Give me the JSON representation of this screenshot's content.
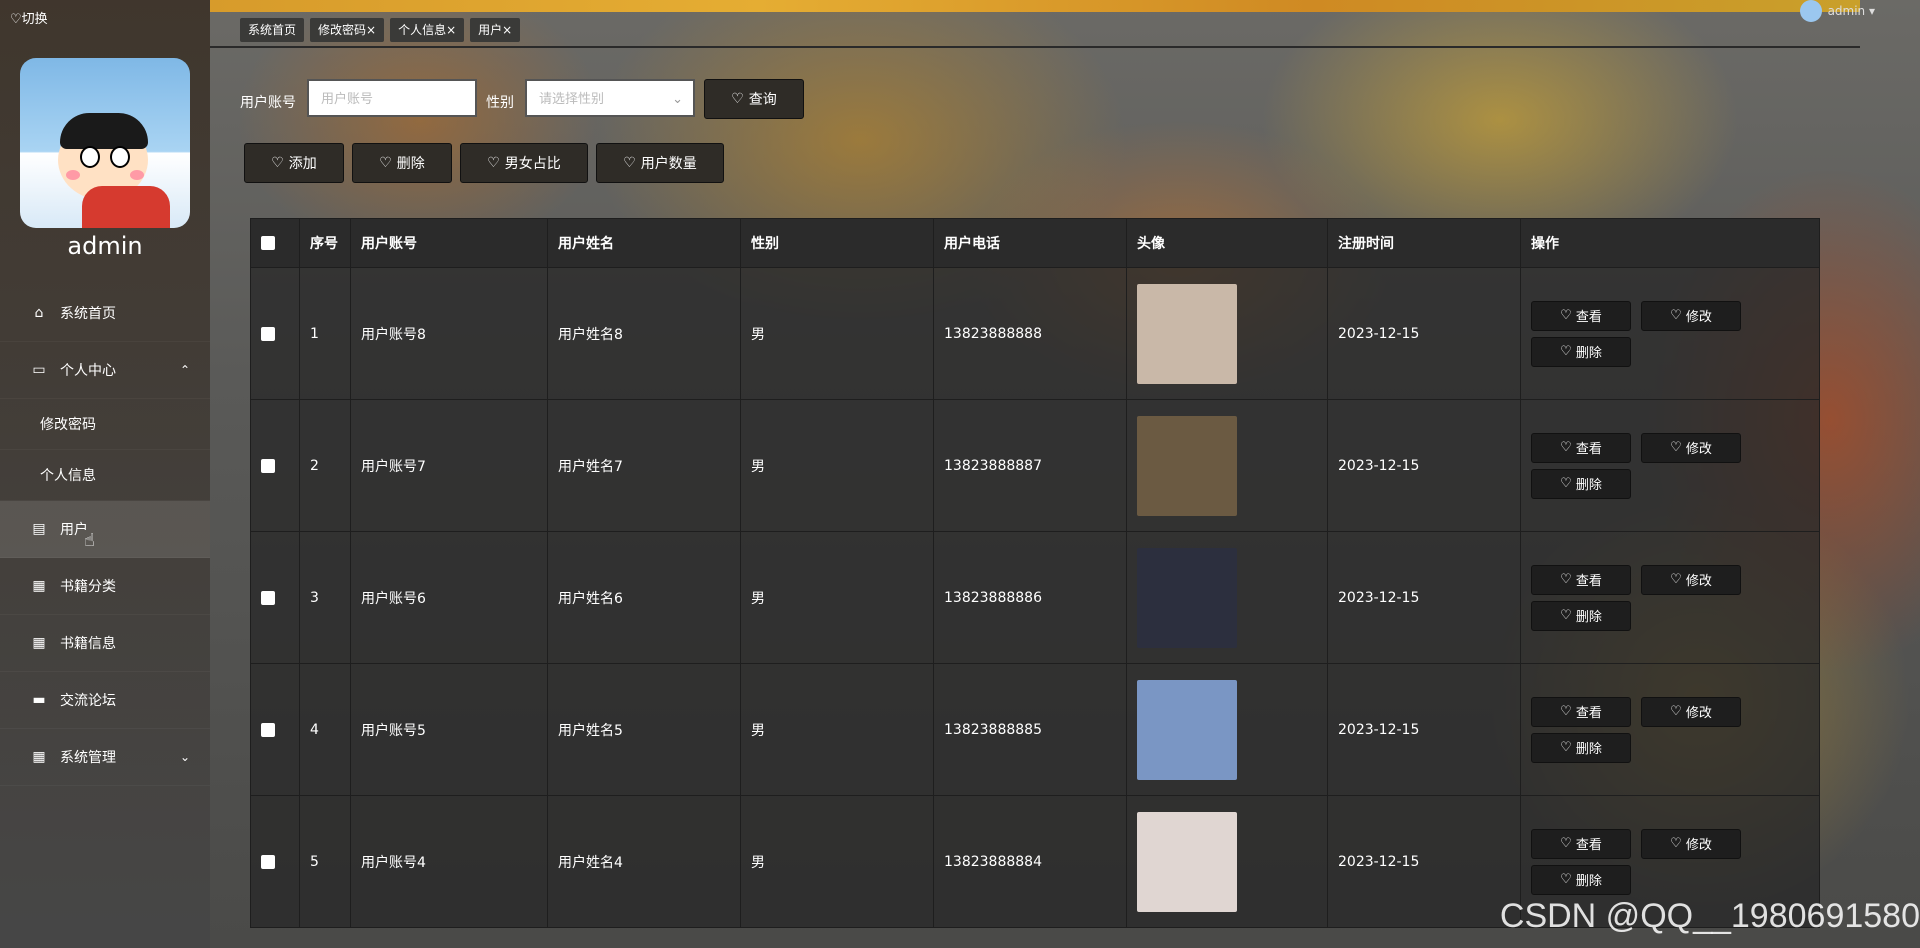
{
  "top": {
    "switch_label": "♡切换",
    "user_label": "admin ▾",
    "tabs": [
      "系统首页",
      "修改密码×",
      "个人信息×",
      "用户×"
    ]
  },
  "sidebar": {
    "username": "admin",
    "items": [
      {
        "icon": "home-icon",
        "glyph": "⌂",
        "label": "系统首页"
      },
      {
        "icon": "card-icon",
        "glyph": "▭",
        "label": "个人中心",
        "chevron": "⌃"
      },
      {
        "label": "修改密码"
      },
      {
        "label": "个人信息"
      },
      {
        "icon": "clipboard-icon",
        "glyph": "▤",
        "label": "用户"
      },
      {
        "icon": "grid-icon",
        "glyph": "▦",
        "label": "书籍分类"
      },
      {
        "icon": "grid-icon",
        "glyph": "▦",
        "label": "书籍信息"
      },
      {
        "icon": "monitor-icon",
        "glyph": "▬",
        "label": "交流论坛"
      },
      {
        "icon": "grid-icon",
        "glyph": "▦",
        "label": "系统管理",
        "chevron": "⌄"
      }
    ]
  },
  "search": {
    "account_label": "用户账号",
    "account_placeholder": "用户账号",
    "gender_label": "性别",
    "gender_placeholder": "请选择性别",
    "query_button": "查询"
  },
  "actions": {
    "add": "添加",
    "delete": "删除",
    "gender_ratio": "男女占比",
    "user_count": "用户数量"
  },
  "table": {
    "headers": [
      "序号",
      "用户账号",
      "用户姓名",
      "性别",
      "用户电话",
      "头像",
      "注册时间",
      "操作"
    ],
    "rows": [
      {
        "no": "1",
        "account": "用户账号8",
        "name": "用户姓名8",
        "gender": "男",
        "phone": "13823888888",
        "date": "2023-12-15",
        "photo_color": "#c9b8a8"
      },
      {
        "no": "2",
        "account": "用户账号7",
        "name": "用户姓名7",
        "gender": "男",
        "phone": "13823888887",
        "date": "2023-12-15",
        "photo_color": "#6b5a42"
      },
      {
        "no": "3",
        "account": "用户账号6",
        "name": "用户姓名6",
        "gender": "男",
        "phone": "13823888886",
        "date": "2023-12-15",
        "photo_color": "#2c2f3e"
      },
      {
        "no": "4",
        "account": "用户账号5",
        "name": "用户姓名5",
        "gender": "男",
        "phone": "13823888885",
        "date": "2023-12-15",
        "photo_color": "#7a96c4"
      },
      {
        "no": "5",
        "account": "用户账号4",
        "name": "用户姓名4",
        "gender": "男",
        "phone": "13823888884",
        "date": "2023-12-15",
        "photo_color": "#e0d6d2"
      }
    ],
    "op_view": "查看",
    "op_edit": "修改",
    "op_delete": "删除"
  },
  "watermark": "CSDN @QQ__1980691580"
}
